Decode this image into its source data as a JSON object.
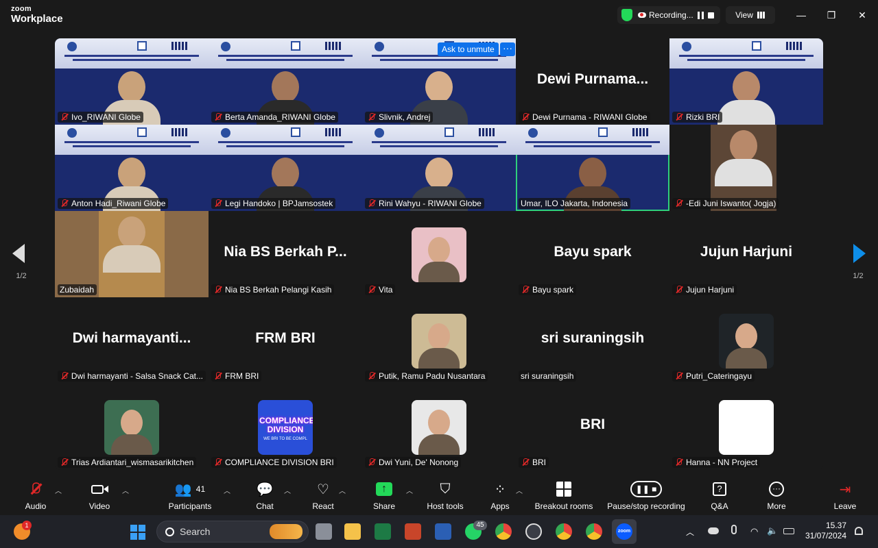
{
  "app": {
    "brand_small": "zoom",
    "brand_large": "Workplace"
  },
  "topbar": {
    "recording_label": "Recording...",
    "view_label": "View"
  },
  "tooltip": {
    "ask_unmute": "Ask to unmute",
    "more": "···"
  },
  "pager": {
    "left": "1/2",
    "right": "1/2"
  },
  "tiles": [
    {
      "name": "Ivo_RIWANI Globe",
      "type": "video"
    },
    {
      "name": "Berta Amanda_RIWANI Globe",
      "type": "video"
    },
    {
      "name": "Slivnik, Andrej",
      "type": "video"
    },
    {
      "name": "Dewi Purnama - RIWANI Globe",
      "type": "text",
      "display": "Dewi  Purnama..."
    },
    {
      "name": "Rizki BRI",
      "type": "video"
    },
    {
      "name": "Anton Hadi_Riwani Globe",
      "type": "video"
    },
    {
      "name": "Legi Handoko | BPJamsostek",
      "type": "video"
    },
    {
      "name": "Rini Wahyu - RIWANI Globe",
      "type": "video"
    },
    {
      "name": "Umar, ILO Jakarta, Indonesia",
      "type": "video",
      "active": true
    },
    {
      "name": "-Edi Juni Iswanto( Jogja)",
      "type": "video"
    },
    {
      "name": "Zubaidah",
      "type": "video"
    },
    {
      "name": "Nia BS Berkah Pelangi Kasih",
      "type": "text",
      "display": "Nia BS Berkah P..."
    },
    {
      "name": "Vita",
      "type": "avatar"
    },
    {
      "name": "Bayu spark",
      "type": "text",
      "display": "Bayu spark"
    },
    {
      "name": "Jujun Harjuni",
      "type": "text",
      "display": "Jujun Harjuni"
    },
    {
      "name": "Dwi harmayanti - Salsa Snack Cat...",
      "type": "text",
      "display": "Dwi  harmayanti..."
    },
    {
      "name": "FRM BRI",
      "type": "text",
      "display": "FRM BRI"
    },
    {
      "name": "Putik, Ramu Padu Nusantara",
      "type": "avatar"
    },
    {
      "name": "sri suraningsih",
      "type": "text",
      "display": "sri suraningsih"
    },
    {
      "name": "Putri_Cateringayu",
      "type": "avatar"
    },
    {
      "name": "Trias Ardiantari_wismasarikitchen",
      "type": "avatar"
    },
    {
      "name": "COMPLIANCE DIVISION BRI",
      "type": "avatar"
    },
    {
      "name": "Dwi Yuni, De' Nonong",
      "type": "avatar"
    },
    {
      "name": "BRI",
      "type": "text",
      "display": "BRI"
    },
    {
      "name": "Hanna - NN Project",
      "type": "avatar"
    }
  ],
  "avatar_text": {
    "compliance": "COMPLIANCE DIVISION",
    "compliance_sub": "WE BRI TO BE COMPL"
  },
  "toolbar": {
    "audio": "Audio",
    "video": "Video",
    "participants": "Participants",
    "participants_count": "41",
    "chat": "Chat",
    "react": "React",
    "share": "Share",
    "host_tools": "Host tools",
    "apps": "Apps",
    "breakout": "Breakout rooms",
    "pause_rec": "Pause/stop recording",
    "qa": "Q&A",
    "more": "More",
    "leave": "Leave"
  },
  "taskbar": {
    "search_placeholder": "Search",
    "notif_badge": "1",
    "whatsapp_badge": "45",
    "time": "15.37",
    "date": "31/07/2024"
  },
  "colors": {
    "accent": "#0e71eb",
    "active_border": "#2fd07c",
    "share_green": "#23d959",
    "leave_red": "#e02828"
  }
}
